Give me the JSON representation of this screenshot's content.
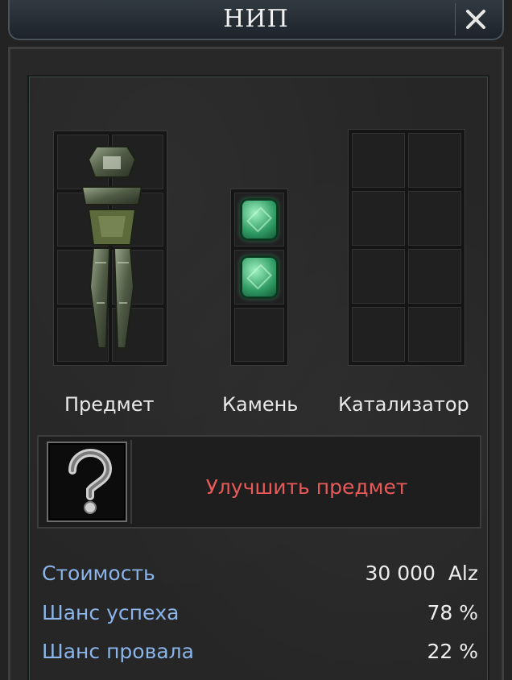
{
  "window": {
    "title": "НИП",
    "close_icon": "close-icon"
  },
  "slots": {
    "item_label": "Предмет",
    "stone_label": "Камень",
    "catalyst_label": "Катализатор",
    "item_icon": "armor-icon",
    "stone_icons": [
      "emerald-gem-icon",
      "emerald-gem-icon"
    ]
  },
  "upgrade": {
    "icon": "question-mark-icon",
    "label": "Улучшить предмет"
  },
  "stats": [
    {
      "label": "Стоимость",
      "value": "30 000  Alz"
    },
    {
      "label": "Шанс успеха",
      "value": "78 %"
    },
    {
      "label": "Шанс провала",
      "value": "22 %"
    }
  ],
  "colors": {
    "title_text": "#f2f2f2",
    "action_text": "#e85a5a",
    "stat_label": "#8ab4ea",
    "stat_value": "#ededed",
    "gem": "#2f9a63"
  }
}
